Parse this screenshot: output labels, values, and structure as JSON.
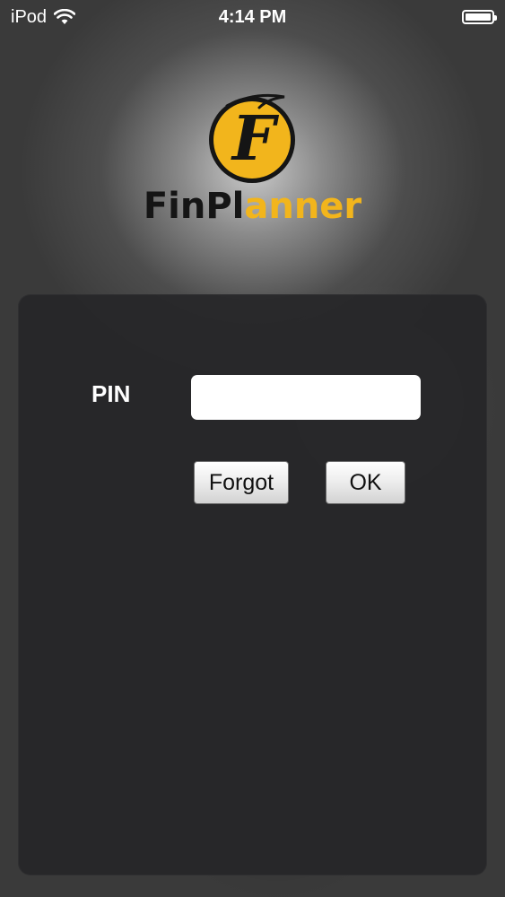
{
  "status_bar": {
    "device": "iPod",
    "time": "4:14 PM",
    "wifi_icon": "wifi-icon",
    "battery_icon": "battery-icon",
    "battery_level": 1.0
  },
  "logo": {
    "monogram": "F",
    "text_part1": "FinPl",
    "text_part2": "anner",
    "brand_yellow": "#f2b51c",
    "brand_dark": "#151515"
  },
  "login": {
    "pin_label": "PIN",
    "pin_value": "",
    "pin_placeholder": "",
    "forgot_label": "Forgot",
    "ok_label": "OK"
  }
}
